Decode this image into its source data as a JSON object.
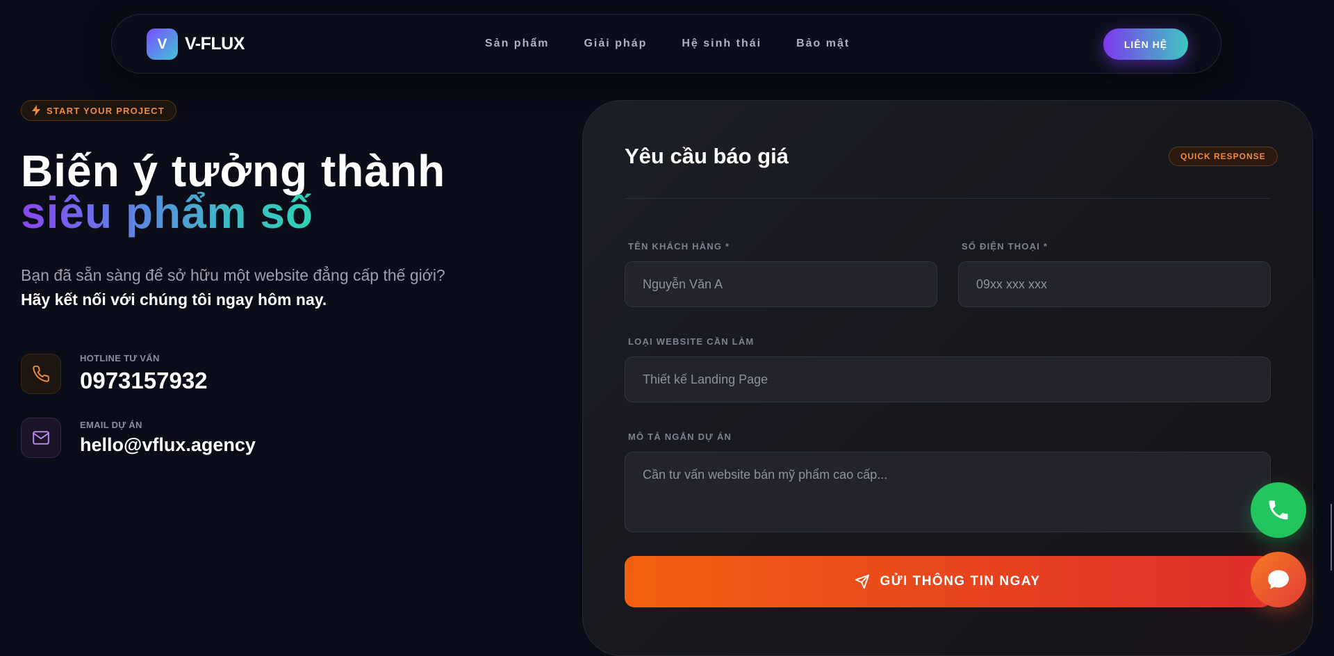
{
  "nav": {
    "logo_mark": "V",
    "logo_text": "V-FLUX",
    "links": [
      "Sản phẩm",
      "Giải pháp",
      "Hệ sinh thái",
      "Bảo mật"
    ],
    "cta_label": "LIÊN HỆ"
  },
  "hero": {
    "badge_icon": "lightning-icon",
    "badge": "START YOUR PROJECT",
    "title_line1": "Biến ý tưởng thành",
    "title_line2": "siêu phẩm số",
    "intro": "Bạn đã sẵn sàng để sở hữu một website đẳng cấp thế giới?",
    "intro_strong": "Hãy kết nối với chúng tôi ngay hôm nay."
  },
  "contacts": [
    {
      "icon": "phone-icon",
      "label": "HOTLINE TƯ VẤN",
      "value": "0973157932"
    },
    {
      "icon": "mail-icon",
      "label": "EMAIL DỰ ÁN",
      "value": "hello@vflux.agency"
    }
  ],
  "form": {
    "title": "Yêu cầu báo giá",
    "badge": "QUICK RESPONSE",
    "fields": {
      "name": {
        "label": "TÊN KHÁCH HÀNG *",
        "placeholder": "Nguyễn Văn A"
      },
      "phone": {
        "label": "SỐ ĐIỆN THOẠI *",
        "placeholder": "09xx xxx xxx"
      },
      "website_type": {
        "label": "LOẠI WEBSITE CẦN LÀM",
        "value": "Thiết kế Landing Page"
      },
      "description": {
        "label": "MÔ TẢ NGẮN DỰ ÁN",
        "placeholder": "Cần tư vấn website bán mỹ phẩm cao cấp..."
      }
    },
    "submit_label": "GỬI THÔNG TIN NGAY"
  },
  "floating": {
    "call_icon": "phone-icon",
    "chat_icon": "chat-bubble-icon"
  },
  "colors": {
    "background": "#0a0d17",
    "accent_orange": "#f08a3c",
    "accent_purple": "#7c3aed",
    "accent_teal": "#3fc6c0",
    "call_green": "#22c55e",
    "submit_start": "#f2610f",
    "submit_end": "#df2c2c"
  }
}
